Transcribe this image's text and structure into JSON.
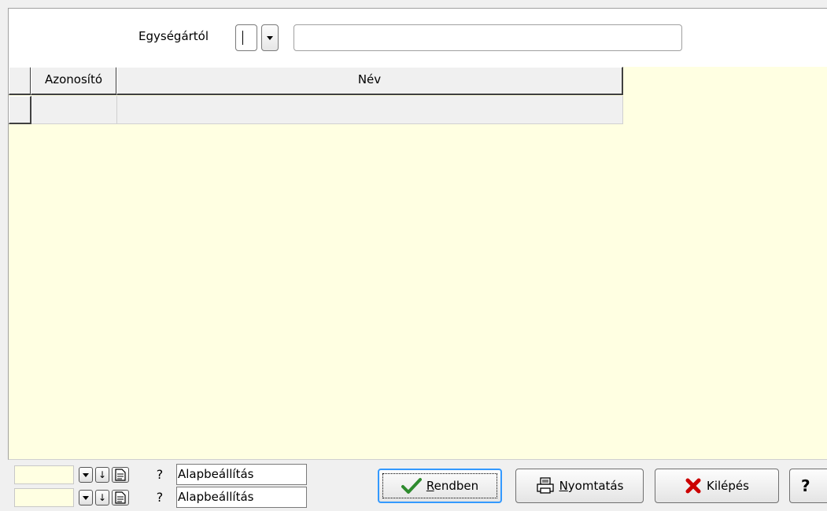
{
  "filter": {
    "label": "Egységártól",
    "code_value": "",
    "name_value": ""
  },
  "grid": {
    "columns": [
      "Azonosító",
      "Név"
    ],
    "rows": [
      [
        "",
        ""
      ]
    ]
  },
  "layouts": [
    {
      "value": "",
      "name": "Alapbeállítás"
    },
    {
      "value": "",
      "name": "Alapbeállítás"
    }
  ],
  "buttons": {
    "ok": {
      "label_mnemonic": "R",
      "label_rest": "endben"
    },
    "print": {
      "label_mnemonic": "N",
      "label_rest": "yomtatás"
    },
    "exit": {
      "label": "Kilépés"
    },
    "help": {
      "label": "?"
    }
  },
  "icons": {
    "ok": "checkmark-icon",
    "print": "printer-icon",
    "exit": "x-icon"
  },
  "colors": {
    "grid_background": "#ffffe2",
    "ok_check": "#2e8b2e",
    "exit_x": "#cc0000",
    "focus_border": "#3399ff"
  }
}
